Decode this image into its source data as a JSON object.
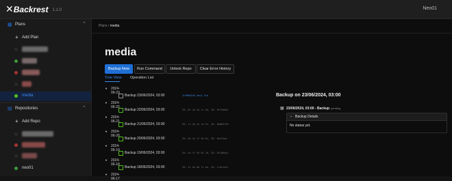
{
  "app": {
    "name": "Backrest",
    "version": "1.1.0",
    "user": "Neo01"
  },
  "sidebar": {
    "plans_label": "Plans",
    "add_plan_label": "Add Plan",
    "active_plan": "media",
    "repos_label": "Repositories",
    "add_repo_label": "Add Repo",
    "repo_last": "neo01"
  },
  "breadcrumb": {
    "root": "Plans",
    "separator": "/",
    "current": "media"
  },
  "page": {
    "title": "media",
    "buttons": {
      "backup_now": "Backup Now",
      "run_command": "Run Command",
      "unlock_repo": "Unlock Repo",
      "clear_error": "Clear Error History"
    },
    "tabs": {
      "tree_view": "Tree View",
      "operation_list": "Operation List"
    }
  },
  "tree": [
    {
      "date": "2024-06-23",
      "backup": "Backup 23/06/2024, 03:00",
      "meta": "1cf8db1d3  wait_ftp"
    },
    {
      "date": "2024-06-22",
      "backup": "Backup 22/06/2024, 03:00",
      "meta": "ID: 8f 4a 2b 1c 9e, ID: 0ff9db8f"
    },
    {
      "date": "2024-06-21",
      "backup": "Backup 21/06/2024, 03:00",
      "meta": "ID: 7c 3b 2a 1e 9c, ID: 0b8b9f10"
    },
    {
      "date": "2024-06-20",
      "backup": "Backup 20/06/2024, 03:00",
      "meta": "ID: 6b 2a 1f 9d 8c, ID: 0e2f5ea"
    },
    {
      "date": "2024-06-19",
      "backup": "Backup 19/06/2024, 03:00",
      "meta": "ID: 5a 1f 9e 8c 7b, ID: 0f1b8ea1"
    },
    {
      "date": "2024-06-18",
      "backup": "Backup 18/06/2024, 03:00",
      "meta": "ID: 4f 9e 8d 7c 6a, ID: 1c5e1a2f"
    },
    {
      "date": "2024-06-17",
      "backup": "",
      "meta": ""
    }
  ],
  "detail": {
    "title": "Backup on 23/06/2024, 03:00",
    "row_text": "23/06/2024, 03:00 - Backup",
    "row_status": "pending",
    "panel_title": "Backup Details",
    "panel_body": "No status yet."
  },
  "colors": {
    "accent": "#1f6fd6",
    "success": "#52c41a",
    "bg": "#141414"
  }
}
